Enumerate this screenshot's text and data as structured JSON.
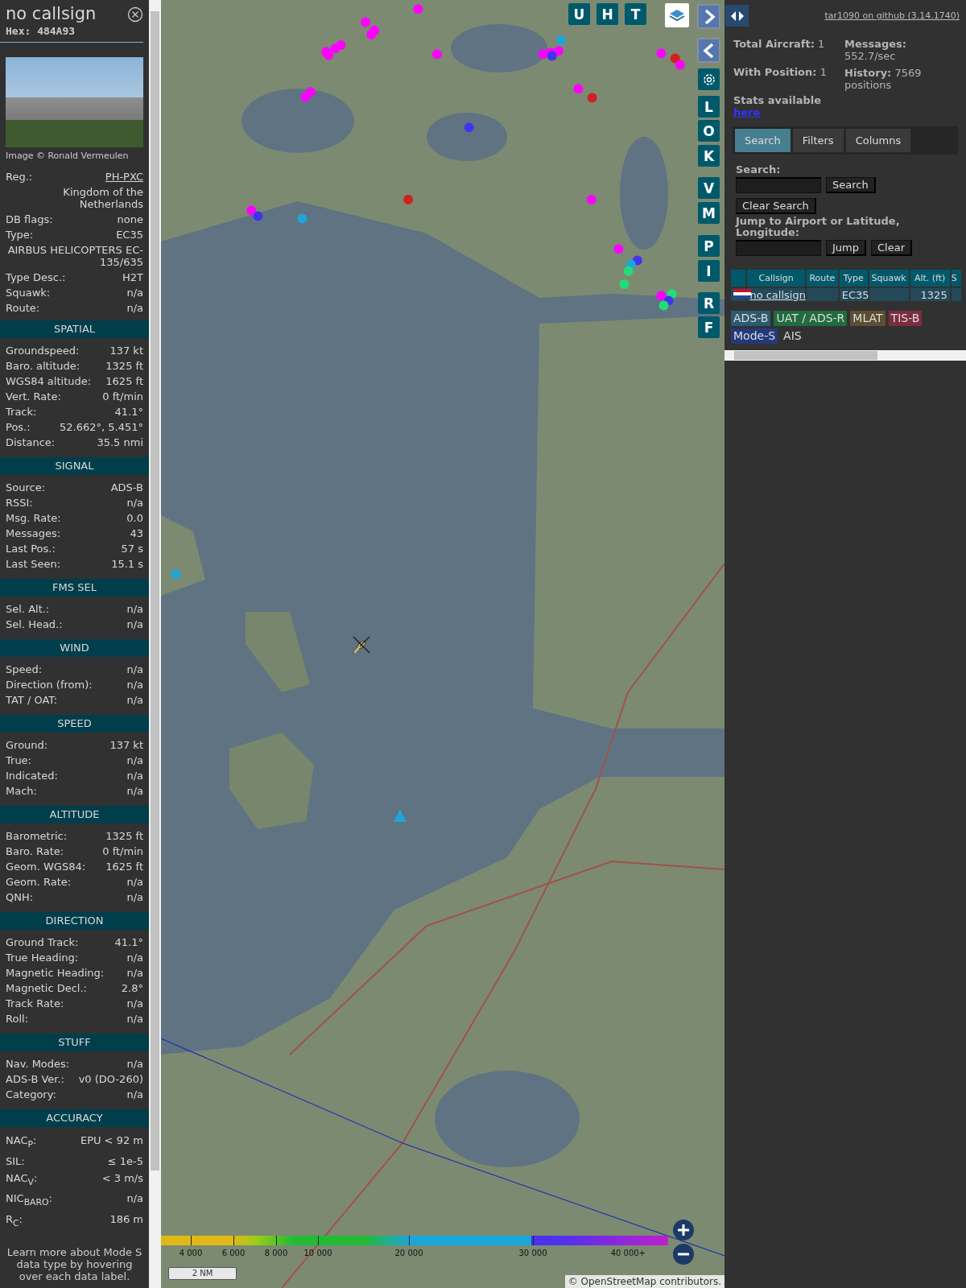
{
  "sidebar": {
    "title": "no callsign",
    "hex": "Hex: 484A93",
    "photo_credit": "Image © Ronald Vermeulen",
    "info": [
      {
        "kind": "link",
        "label": "Reg.:",
        "value": "PH-PXC"
      },
      {
        "kind": "note",
        "value": "Kingdom of the Netherlands"
      },
      {
        "kind": "pair",
        "label": "DB flags:",
        "value": "none"
      },
      {
        "kind": "pair",
        "label": "Type:",
        "value": "EC35"
      },
      {
        "kind": "note",
        "value": "AIRBUS HELICOPTERS EC-135/635"
      },
      {
        "kind": "pair",
        "label": "Type Desc.:",
        "value": "H2T"
      },
      {
        "kind": "pair",
        "label": "Squawk:",
        "value": "n/a"
      },
      {
        "kind": "pair",
        "label": "Route:",
        "value": "n/a"
      }
    ],
    "sections": [
      {
        "title": "SPATIAL",
        "rows": [
          {
            "label": "Groundspeed:",
            "value": "137 kt"
          },
          {
            "label": "Baro. altitude:",
            "value": "1325 ft"
          },
          {
            "label": "WGS84 altitude:",
            "value": "1625 ft"
          },
          {
            "label": "Vert. Rate:",
            "value": "0 ft/min"
          },
          {
            "label": "Track:",
            "value": "41.1°"
          },
          {
            "label": "Pos.:",
            "value": "52.662°, 5.451°"
          },
          {
            "label": "Distance:",
            "value": "35.5 nmi"
          }
        ]
      },
      {
        "title": "SIGNAL",
        "rows": [
          {
            "label": "Source:",
            "value": "ADS-B"
          },
          {
            "label": "RSSI:",
            "value": "n/a"
          },
          {
            "label": "Msg. Rate:",
            "value": "0.0"
          },
          {
            "label": "Messages:",
            "value": "43"
          },
          {
            "label": "Last Pos.:",
            "value": "57 s"
          },
          {
            "label": "Last Seen:",
            "value": "15.1 s"
          }
        ]
      },
      {
        "title": "FMS SEL",
        "rows": [
          {
            "label": "Sel. Alt.:",
            "value": "n/a"
          },
          {
            "label": "Sel. Head.:",
            "value": "n/a"
          }
        ]
      },
      {
        "title": "WIND",
        "rows": [
          {
            "label": "Speed:",
            "value": "n/a"
          },
          {
            "label": "Direction (from):",
            "value": "n/a"
          },
          {
            "label": "TAT / OAT:",
            "value": "n/a"
          }
        ]
      },
      {
        "title": "SPEED",
        "rows": [
          {
            "label": "Ground:",
            "value": "137 kt"
          },
          {
            "label": "True:",
            "value": "n/a"
          },
          {
            "label": "Indicated:",
            "value": "n/a"
          },
          {
            "label": "Mach:",
            "value": "n/a"
          }
        ]
      },
      {
        "title": "ALTITUDE",
        "rows": [
          {
            "label": "Barometric:",
            "value": "1325 ft"
          },
          {
            "label": "Baro. Rate:",
            "value": "0 ft/min"
          },
          {
            "label": "Geom. WGS84:",
            "value": "1625 ft"
          },
          {
            "label": "Geom. Rate:",
            "value": "n/a"
          },
          {
            "label": "QNH:",
            "value": "n/a"
          }
        ]
      },
      {
        "title": "DIRECTION",
        "rows": [
          {
            "label": "Ground Track:",
            "value": "41.1°"
          },
          {
            "label": "True Heading:",
            "value": "n/a"
          },
          {
            "label": "Magnetic Heading:",
            "value": "n/a"
          },
          {
            "label": "Magnetic Decl.:",
            "value": "2.8°"
          },
          {
            "label": "Track Rate:",
            "value": "n/a"
          },
          {
            "label": "Roll:",
            "value": "n/a"
          }
        ]
      },
      {
        "title": "STUFF",
        "rows": [
          {
            "label": "Nav. Modes:",
            "value": "n/a"
          },
          {
            "label": "ADS-B Ver.:",
            "value": "v0 (DO-260)"
          },
          {
            "label": "Category:",
            "value": "n/a"
          }
        ]
      },
      {
        "title": "ACCURACY",
        "rows": [
          {
            "label": "NAC$_{P}$:",
            "value": "EPU < 92 m"
          },
          {
            "label": "SIL:",
            "value": "≤ 1e-5"
          },
          {
            "label": "NAC$_{V}$:",
            "value": "< 3 m/s"
          },
          {
            "label": "NIC$_{BARO}$:",
            "value": "n/a"
          },
          {
            "label": "R$_{C}$:",
            "value": "186 m"
          }
        ]
      }
    ],
    "footer": "Learn more about Mode S data type by hovering over each data label."
  },
  "map": {
    "top_buttons": [
      "U",
      "H",
      "T"
    ],
    "side_buttons": [
      "L",
      "O",
      "K",
      "V",
      "M",
      "P",
      "I",
      "R",
      "F"
    ],
    "altitude_legend": [
      "4 000",
      "6 000",
      "8 000",
      "10 000",
      "20 000",
      "30 000",
      "40 000+"
    ],
    "scale": "2 NM",
    "attribution": {
      "prefix": "©",
      "link": "OpenStreetMap",
      "suffix": "contributors."
    }
  },
  "panel": {
    "github_link": "tar1090 on github (3.14.1740)",
    "stats_left": [
      "**Total Aircraft:** 1",
      "**With Position:** 1"
    ],
    "stats_right": [
      "**Messages:** 552.7/sec",
      "**History:** 7569 positions"
    ],
    "stats_note": {
      "text": "Stats available",
      "link": "here"
    },
    "tabs": [
      {
        "label": "Search",
        "selected": true
      },
      {
        "label": "Filters",
        "selected": false
      },
      {
        "label": "Columns",
        "selected": false
      }
    ],
    "search": {
      "label": "Search:",
      "button": "Search",
      "clear_button": "Clear Search"
    },
    "jump": {
      "label": "Jump to Airport or Latitude, Longitude:",
      "button": "Jump",
      "clear_button": "Clear"
    },
    "table": {
      "columns": [
        "Callsign",
        "Route",
        "Type",
        "Squawk",
        "Alt. (ft)",
        "S"
      ],
      "rows": [
        {
          "callsign": "no callsign",
          "type": "EC35",
          "altitude": "1325"
        }
      ]
    },
    "legend": [
      {
        "label": "ADS-B",
        "color": "#2b5b70"
      },
      {
        "label": "UAT / ADS-R",
        "color": "#216b3e"
      },
      {
        "label": "MLAT",
        "color": "#5c4e33"
      },
      {
        "label": "TIS-B",
        "color": "#7a2d40"
      },
      {
        "label": "Mode-S",
        "color": "#223a7c"
      },
      {
        "label": "AIS"
      }
    ]
  }
}
